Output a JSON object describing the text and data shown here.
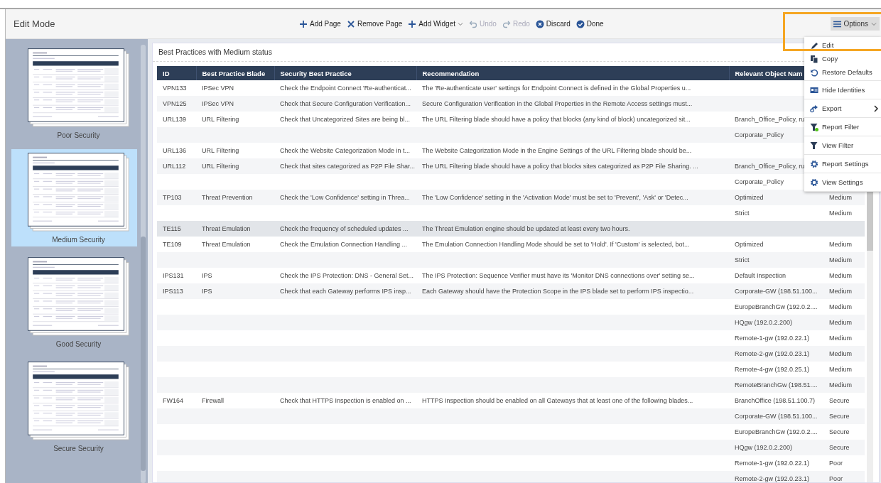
{
  "header": {
    "title": "Edit Mode",
    "toolbar": [
      {
        "label": "Add Page",
        "disabled": false,
        "dropdown": false
      },
      {
        "label": "Remove Page",
        "disabled": false,
        "dropdown": false
      },
      {
        "label": "Add Widget",
        "disabled": false,
        "dropdown": true
      },
      {
        "label": "Undo",
        "disabled": true,
        "dropdown": false
      },
      {
        "label": "Redo",
        "disabled": true,
        "dropdown": false
      },
      {
        "label": "Discard",
        "disabled": false,
        "dropdown": false
      },
      {
        "label": "Done",
        "disabled": false,
        "dropdown": false
      }
    ],
    "options_button": {
      "label": "Options",
      "expanded": true
    }
  },
  "pages": [
    {
      "label": "Poor Security",
      "selected": false
    },
    {
      "label": "Medium Security",
      "selected": true
    },
    {
      "label": "Good Security",
      "selected": false
    },
    {
      "label": "Secure Security",
      "selected": false
    }
  ],
  "widget": {
    "title": "Best Practices with Medium status",
    "table": {
      "columns": [
        "ID",
        "Best Practice Blade",
        "Security Best Practice",
        "Recommendation",
        "Relevant Object Nam"
      ],
      "rows": [
        {
          "highlighted": false,
          "cells": [
            "VPN133",
            "IPSec VPN",
            "Check the Endpoint Connect 'Re-authenticat...",
            "The 'Re-authenticate user' settings for Endpoint Connect is defined in the Global Properties u...",
            null,
            null
          ]
        },
        {
          "highlighted": false,
          "cells": [
            "VPN125",
            "IPSec VPN",
            "Check that Secure Configuration Verification...",
            "Secure Configuration Verification in the Global Properties in the Remote Access settings must...",
            null,
            null
          ]
        },
        {
          "highlighted": false,
          "cells": [
            "URL139",
            "URL Filtering",
            "Check that Uncategorized Sites are being bl...",
            "The URL Filtering blade should have a policy that blocks (any kind of block) uncategorized sit...",
            "Branch_Office_Policy, ru",
            null
          ]
        },
        {
          "highlighted": false,
          "cells": [
            null,
            null,
            null,
            null,
            "Corporate_Policy",
            null
          ]
        },
        {
          "highlighted": false,
          "cells": [
            "URL136",
            "URL Filtering",
            "Check the Website Categorization Mode in t...",
            "The Website Categorization Mode in the Engine Settings of the URL Filtering blade should be...",
            null,
            null
          ]
        },
        {
          "highlighted": false,
          "cells": [
            "URL112",
            "URL Filtering",
            "Check that sites categorized as P2P File Shar...",
            "The URL Filtering blade should have a policy that blocks sites categorized as P2P File Sharing. ...",
            "Branch_Office_Policy, ru",
            null
          ]
        },
        {
          "highlighted": false,
          "cells": [
            null,
            null,
            null,
            null,
            "Corporate_Policy",
            null
          ]
        },
        {
          "highlighted": false,
          "cells": [
            "TP103",
            "Threat Prevention",
            "Check the 'Low Confidence' setting in Threa...",
            "The 'Low Confidence' setting in the 'Activation Mode' must be set to 'Prevent', 'Ask' or 'Detec...",
            "Optimized",
            "Medium"
          ]
        },
        {
          "highlighted": false,
          "cells": [
            null,
            null,
            null,
            null,
            "Strict",
            "Medium"
          ]
        },
        {
          "highlighted": true,
          "cells": [
            "TE115",
            "Threat Emulation",
            "Check the frequency of scheduled updates ...",
            "The Threat Emulation engine should be updated at least every two hours.",
            null,
            null
          ]
        },
        {
          "highlighted": false,
          "cells": [
            "TE109",
            "Threat Emulation",
            "Check the Emulation Connection Handling ...",
            "The Emulation Connection Handling Mode should be set to 'Hold'. If 'Custom' is selected, bot...",
            "Optimized",
            "Medium"
          ]
        },
        {
          "highlighted": false,
          "cells": [
            null,
            null,
            null,
            null,
            "Strict",
            "Medium"
          ]
        },
        {
          "highlighted": false,
          "cells": [
            "IPS131",
            "IPS",
            "Check the IPS Protection: DNS - General Set...",
            "The IPS Protection: Sequence Verifier must have its 'Monitor DNS connections over' setting se...",
            "Default Inspection",
            "Medium"
          ]
        },
        {
          "highlighted": false,
          "cells": [
            "IPS113",
            "IPS",
            "Check that each Gateway performs IPS insp...",
            "Each Gateway should have the Protection Scope in the IPS blade set to perform IPS inspectio...",
            "Corporate-GW (198.51.100...",
            "Medium"
          ]
        },
        {
          "highlighted": false,
          "cells": [
            null,
            null,
            null,
            null,
            "EuropeBranchGw (192.0.2....",
            "Medium"
          ]
        },
        {
          "highlighted": false,
          "cells": [
            null,
            null,
            null,
            null,
            "HQgw (192.0.2.200)",
            "Medium"
          ]
        },
        {
          "highlighted": false,
          "cells": [
            null,
            null,
            null,
            null,
            "Remote-1-gw (192.0.22.1)",
            "Medium"
          ]
        },
        {
          "highlighted": false,
          "cells": [
            null,
            null,
            null,
            null,
            "Remote-2-gw (192.0.23.1)",
            "Medium"
          ]
        },
        {
          "highlighted": false,
          "cells": [
            null,
            null,
            null,
            null,
            "Remote-4-gw (192.0.25.1)",
            "Medium"
          ]
        },
        {
          "highlighted": false,
          "cells": [
            null,
            null,
            null,
            null,
            "RemoteBranchGw (198.51....",
            "Medium"
          ]
        },
        {
          "highlighted": false,
          "cells": [
            "FW164",
            "Firewall",
            "Check that HTTPS Inspection is enabled on ...",
            "HTTPS Inspection should be enabled on all Gateways that at least one of the following blades...",
            "BranchOffice (198.51.100.7)",
            "Secure"
          ]
        },
        {
          "highlighted": false,
          "cells": [
            null,
            null,
            null,
            null,
            "Corporate-GW (198.51.100...",
            "Secure"
          ]
        },
        {
          "highlighted": false,
          "cells": [
            null,
            null,
            null,
            null,
            "EuropeBranchGw (192.0.2....",
            "Secure"
          ]
        },
        {
          "highlighted": false,
          "cells": [
            null,
            null,
            null,
            null,
            "HQgw (192.0.2.200)",
            "Secure"
          ]
        },
        {
          "highlighted": false,
          "cells": [
            null,
            null,
            null,
            null,
            "Remote-1-gw (192.0.22.1)",
            "Poor"
          ]
        },
        {
          "highlighted": false,
          "cells": [
            null,
            null,
            null,
            null,
            "Remote-2-gw (192.0.23.1)",
            "Poor"
          ]
        }
      ]
    }
  },
  "options_menu": {
    "groups": [
      [
        {
          "label": "Edit",
          "submenu": false,
          "indicator": false
        },
        {
          "label": "Copy",
          "submenu": false,
          "indicator": false
        },
        {
          "label": "Restore Defaults",
          "submenu": false,
          "indicator": false
        }
      ],
      [
        {
          "label": "Hide Identities",
          "submenu": false,
          "indicator": false
        }
      ],
      [
        {
          "label": "Export",
          "submenu": true,
          "indicator": false
        }
      ],
      [
        {
          "label": "Report Filter",
          "submenu": false,
          "indicator": true
        }
      ],
      [
        {
          "label": "View Filter",
          "submenu": false,
          "indicator": false
        }
      ],
      [
        {
          "label": "Report Settings",
          "submenu": false,
          "indicator": false
        }
      ],
      [
        {
          "label": "View Settings",
          "submenu": false,
          "indicator": false
        }
      ]
    ]
  }
}
